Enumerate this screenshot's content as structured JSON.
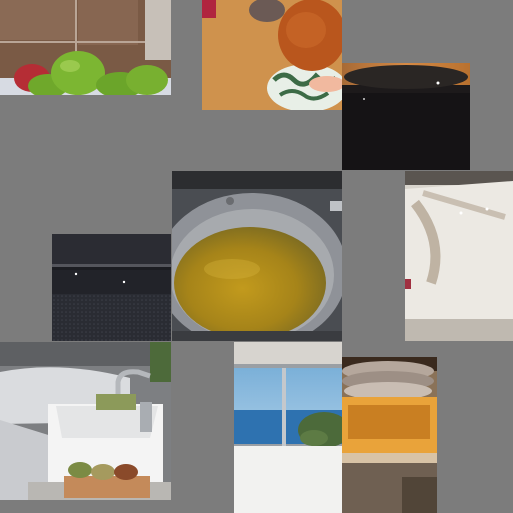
{
  "canvas": {
    "background": "#7c7c7c"
  },
  "tiles": [
    {
      "id": "apples",
      "description_icon": "green-apples-on-tile-floor"
    },
    {
      "id": "spatula",
      "description_icon": "wooden-spatula-over-bowl"
    },
    {
      "id": "dark",
      "description_icon": "dark-appliance-surface"
    },
    {
      "id": "pan",
      "description_icon": "frying-pan-with-oil"
    },
    {
      "id": "tub",
      "description_icon": "white-bathtub"
    },
    {
      "id": "panel",
      "description_icon": "black-glass-panel"
    },
    {
      "id": "sink",
      "description_icon": "bathroom-sink-with-towels"
    },
    {
      "id": "window",
      "description_icon": "window-sea-view"
    },
    {
      "id": "tray",
      "description_icon": "wooden-tray-with-plates"
    }
  ]
}
